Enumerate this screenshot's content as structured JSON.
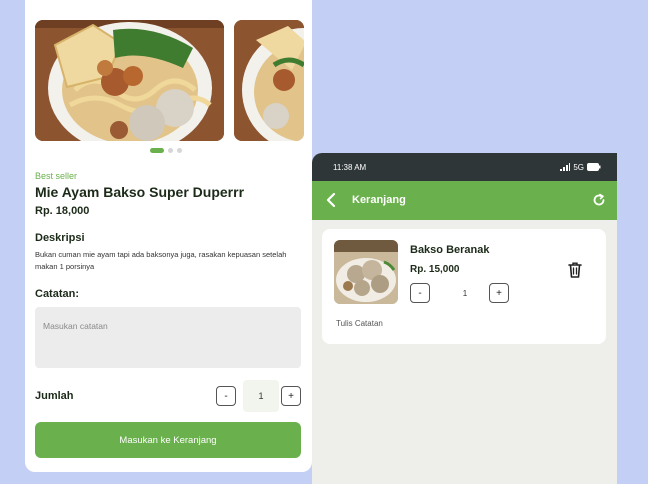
{
  "detail": {
    "badge": "Best seller",
    "title": "Mie Ayam Bakso Super Duperrr",
    "price": "Rp. 18,000",
    "description_heading": "Deskripsi",
    "description": "Bukan cuman mie ayam tapi ada baksonya juga, rasakan kepuasan setelah makan 1 porsinya",
    "note_heading": "Catatan:",
    "note_placeholder": "Masukan catatan",
    "quantity_label": "Jumlah",
    "minus_label": "-",
    "quantity": "1",
    "plus_label": "+",
    "add_to_cart_label": "Masukan ke Keranjang",
    "carousel_pages": 3,
    "carousel_active": 1
  },
  "phone": {
    "status_time": "11:38 AM",
    "network": "5G",
    "title": "Keranjang",
    "cart_items": [
      {
        "name": "Bakso Beranak",
        "price": "Rp. 15,000",
        "minus_label": "-",
        "quantity": "1",
        "plus_label": "+",
        "note_link": "Tulis Catatan"
      }
    ]
  },
  "icons": {
    "back": "chevron-left-icon",
    "refresh": "refresh-icon",
    "delete": "trash-icon",
    "signal": "signal-icon",
    "battery": "battery-icon"
  },
  "colors": {
    "accent": "#6ab04c",
    "background": "#c3cff5",
    "status_bar": "#2f3638"
  }
}
